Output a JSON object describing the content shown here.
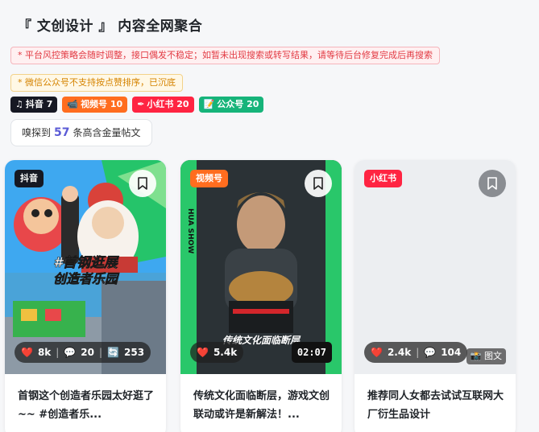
{
  "page": {
    "title": "『 文创设计 』 内容全网聚合",
    "notice_red": "* 平台风控策略会随时调整，接口偶发不稳定；如暂未出现搜索或转写结果，请等待后台修复完成后再搜索",
    "notice_orange": "* 微信公众号不支持按点赞排序，已沉底"
  },
  "platform_tags": [
    {
      "icon": "music-note-icon",
      "glyph": "♫",
      "label": "抖音 7"
    },
    {
      "icon": "video-camera-icon",
      "glyph": "📹",
      "label": "视频号 10"
    },
    {
      "icon": "pen-icon",
      "glyph": "✒",
      "label": "小红书 20"
    },
    {
      "icon": "memo-icon",
      "glyph": "📝",
      "label": "公众号 20"
    }
  ],
  "summary": {
    "prefix": "嗅探到",
    "count": "57",
    "suffix": "条高含金量帖文"
  },
  "cards": [
    {
      "platform": "抖音",
      "likes": "8k",
      "comments": "20",
      "shares": "253",
      "overlay_text_1": "#首钢逛展",
      "overlay_text_2": "创造者乐园",
      "caption": "首钢这个创造者乐园太好逛了~~ #创造者乐..."
    },
    {
      "platform": "视频号",
      "likes": "5.4k",
      "duration": "02:07",
      "side_text": "HUA SHOW",
      "overlay_text": "传统文化面临断层",
      "caption": "传统文化面临断层，游戏文创联动或许是新解法！..."
    },
    {
      "platform": "小红书",
      "likes": "2.4k",
      "comments": "104",
      "type_label": "图文",
      "caption": "推荐同人女都去试试互联网大厂衍生品设计"
    }
  ],
  "colors": {
    "douyin": "#161823",
    "shipin": "#ff6d1f",
    "xhs": "#ff2442",
    "gzh": "#16b47a",
    "accent": "#5b5bd6"
  }
}
